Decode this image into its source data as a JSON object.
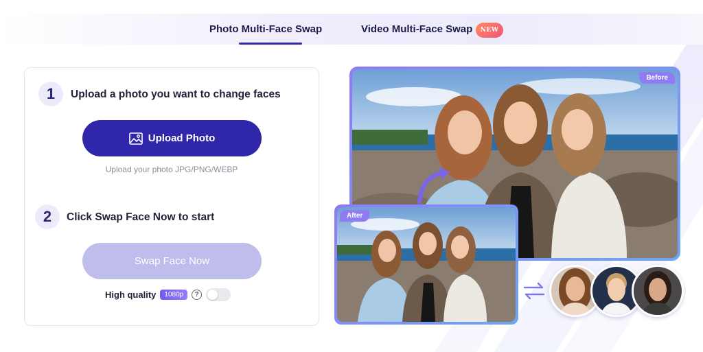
{
  "tabs": {
    "photo_label": "Photo Multi-Face Swap",
    "video_label": "Video Multi-Face Swap",
    "new_badge": "NEW"
  },
  "upload_card": {
    "step1_number": "1",
    "step1_title": "Upload a photo you want to change faces",
    "upload_button_label": "Upload Photo",
    "upload_hint": "Upload your photo JPG/PNG/WEBP",
    "step2_number": "2",
    "step2_title": "Click Swap Face Now to start",
    "swap_button_label": "Swap Face Now",
    "quality_label": "High quality",
    "quality_badge": "1080p",
    "quality_toggle_on": false
  },
  "preview": {
    "before_label": "Before",
    "after_label": "After"
  },
  "colors": {
    "primary": "#2f26a9",
    "disabled_button": "#bfbdeb",
    "accent_gradient_start": "#8d7cf5",
    "accent_gradient_end": "#6ea5f5"
  },
  "icons": {
    "upload": "image-icon",
    "help": "question-icon",
    "swap": "swap-arrows-icon",
    "arrow": "curved-arrow-icon"
  }
}
